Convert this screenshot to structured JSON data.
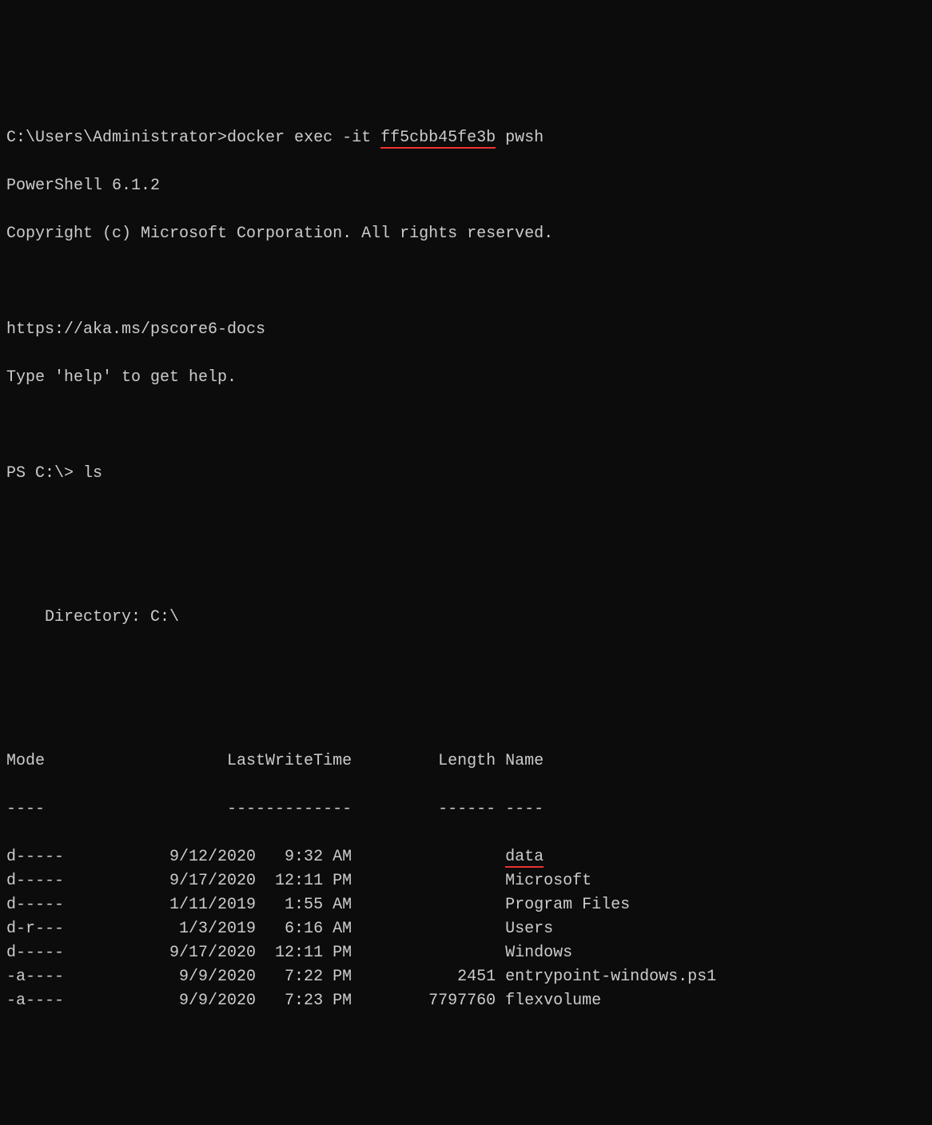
{
  "prompt1_prefix": "C:\\Users\\Administrator>",
  "prompt1_cmd_part1": "docker exec -it ",
  "prompt1_cmd_highlight": "ff5cbb45fe3b",
  "prompt1_cmd_part2": " pwsh",
  "ps_version": "PowerShell 6.1.2",
  "copyright": "Copyright (c) Microsoft Corporation. All rights reserved.",
  "docs_url": "https://aka.ms/pscore6-docs",
  "help_hint": "Type 'help' to get help.",
  "prompt2": "PS C:\\> ls",
  "dir_label": "    Directory: C:\\",
  "header": {
    "mode": "Mode",
    "lwt": "LastWriteTime",
    "length": "Length",
    "name": "Name"
  },
  "header_sep": {
    "mode": "----",
    "lwt": "-------------",
    "length": "------",
    "name": "----"
  },
  "rows": [
    {
      "mode": "d-----",
      "date": "9/12/2020",
      "time": "9:32 AM",
      "length": "",
      "name": "data",
      "hl": true
    },
    {
      "mode": "d-----",
      "date": "9/17/2020",
      "time": "12:11 PM",
      "length": "",
      "name": "Microsoft",
      "hl": false
    },
    {
      "mode": "d-----",
      "date": "1/11/2019",
      "time": "1:55 AM",
      "length": "",
      "name": "Program Files",
      "hl": false
    },
    {
      "mode": "d-r---",
      "date": "1/3/2019",
      "time": "6:16 AM",
      "length": "",
      "name": "Users",
      "hl": false
    },
    {
      "mode": "d-----",
      "date": "9/17/2020",
      "time": "12:11 PM",
      "length": "",
      "name": "Windows",
      "hl": false
    },
    {
      "mode": "-a----",
      "date": "9/9/2020",
      "time": "7:22 PM",
      "length": "2451",
      "name": "entrypoint-windows.ps1",
      "hl": false
    },
    {
      "mode": "-a----",
      "date": "9/9/2020",
      "time": "7:23 PM",
      "length": "7797760",
      "name": "flexvolume",
      "hl": false
    }
  ]
}
